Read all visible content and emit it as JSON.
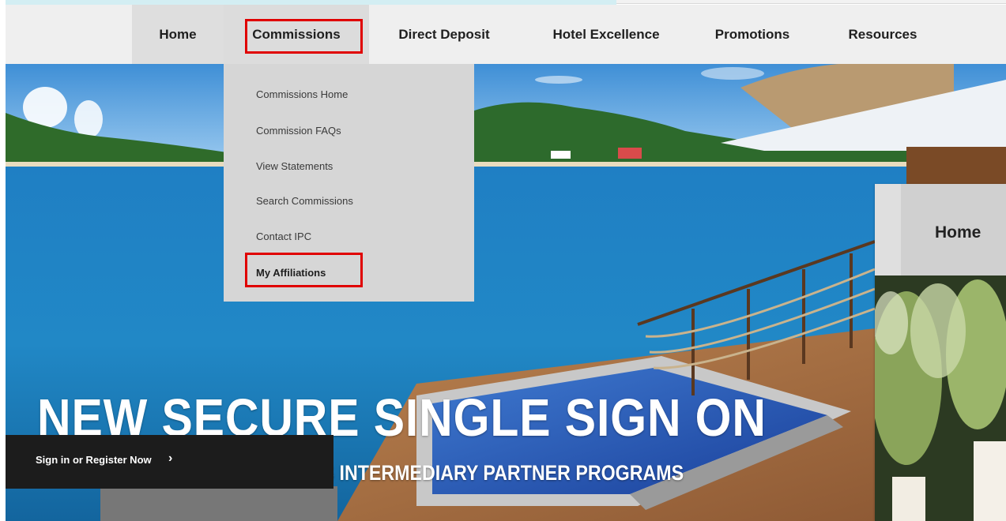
{
  "nav": {
    "items": [
      {
        "label": "Home"
      },
      {
        "label": "Commissions"
      },
      {
        "label": "Direct Deposit"
      },
      {
        "label": "Hotel Excellence"
      },
      {
        "label": "Promotions"
      },
      {
        "label": "Resources"
      }
    ],
    "highlighted": "Commissions"
  },
  "dropdown": {
    "items": [
      {
        "label": "Commissions Home"
      },
      {
        "label": "Commission FAQs"
      },
      {
        "label": "View Statements"
      },
      {
        "label": "Search Commissions"
      },
      {
        "label": "Contact IPC"
      },
      {
        "label": "My Affiliations"
      }
    ],
    "highlighted": "My Affiliations"
  },
  "hero": {
    "headline": "NEW SECURE SINGLE SIGN ON",
    "subheadline": "ACCESS TO ALL OF MARRIOTT'S INTERMEDIARY PARTNER PROGRAMS",
    "cta_label": "Sign in or Register Now",
    "cta_icon": "chevron-right-icon"
  },
  "overlay": {
    "nav_label": "Home"
  },
  "colors": {
    "nav_bg": "#efefef",
    "active_tab_bg": "#dcdcdc",
    "dropdown_bg": "#d6d6d6",
    "highlight_box": "#e00000",
    "cta_bg": "#1c1c1c"
  }
}
